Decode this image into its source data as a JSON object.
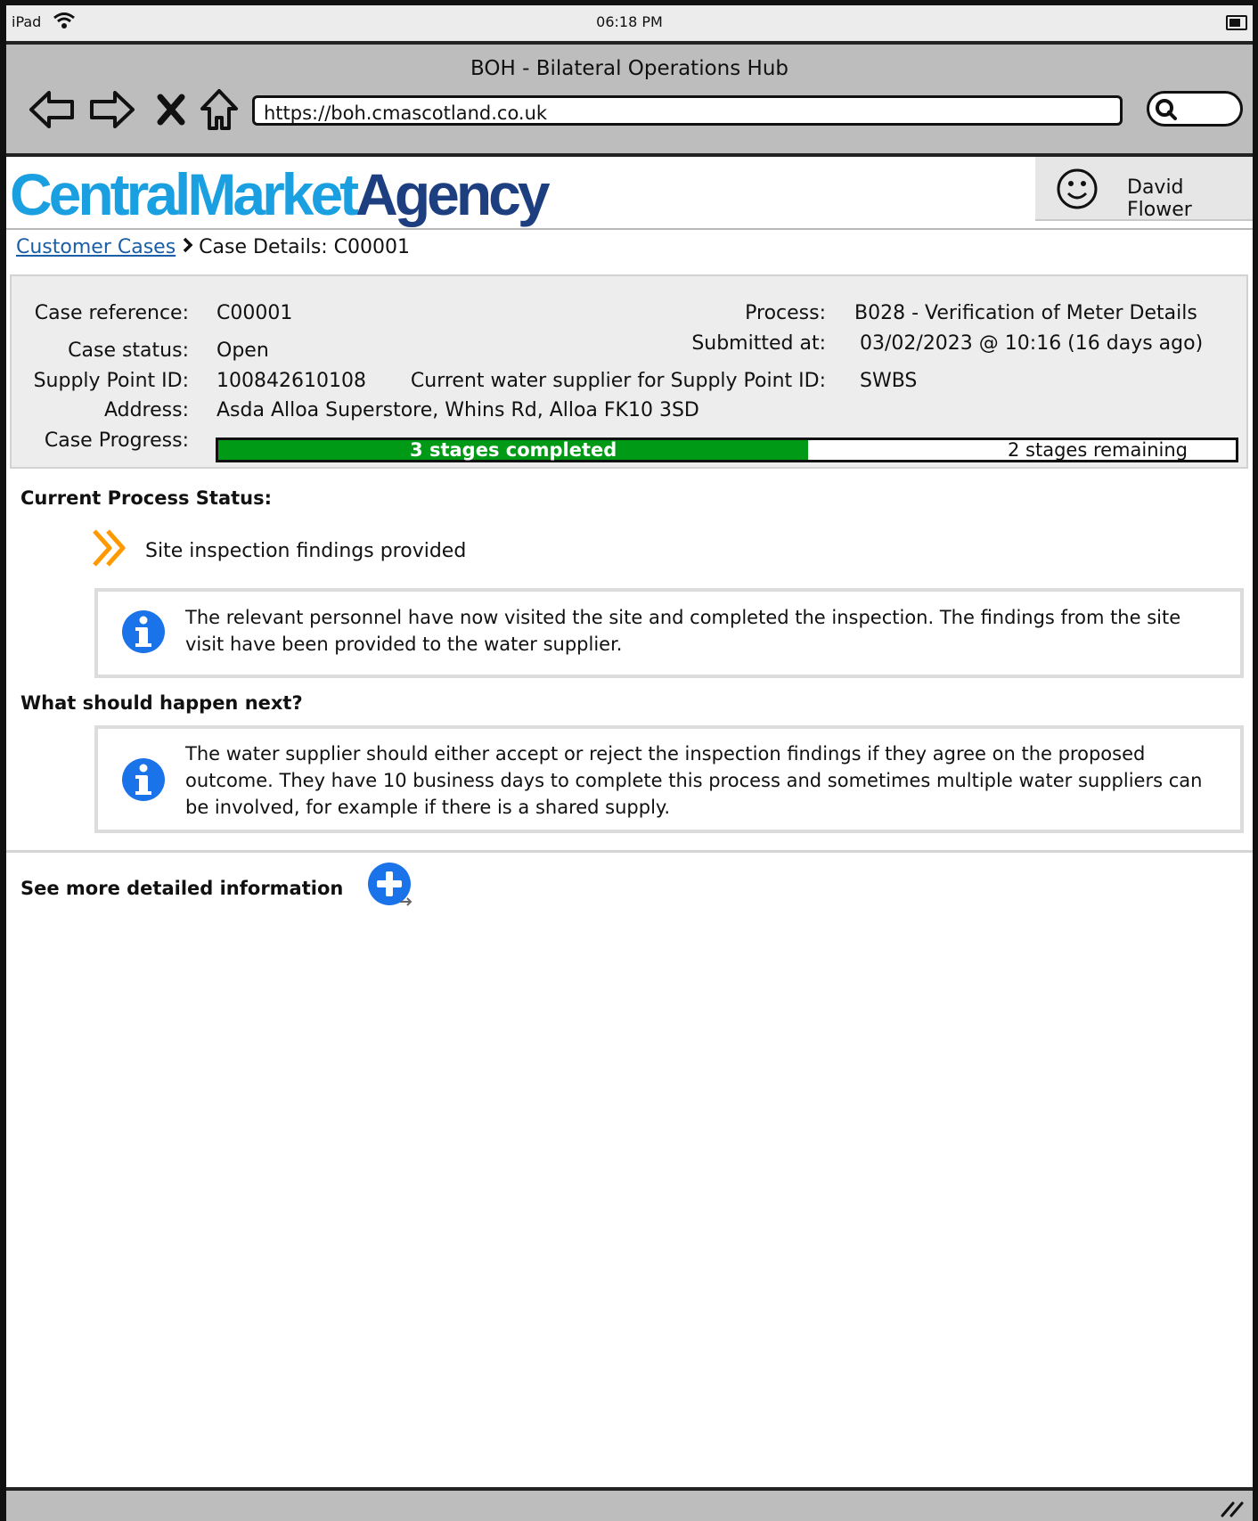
{
  "status_bar": {
    "device": "iPad",
    "time": "06:18 PM"
  },
  "browser": {
    "title": "BOH - Bilateral Operations Hub",
    "url": "https://boh.cmascotland.co.uk"
  },
  "header": {
    "logo_part1": "CentralMarket",
    "logo_part2": "Agency",
    "user_name": "David Flower"
  },
  "breadcrumb": {
    "link": "Customer Cases",
    "current": "Case Details: C00001"
  },
  "summary": {
    "case_reference_label": "Case reference:",
    "case_reference": "C00001",
    "case_status_label": "Case status:",
    "case_status": "Open",
    "supply_point_label": "Supply Point ID:",
    "supply_point": "100842610108",
    "address_label": "Address:",
    "address": "Asda Alloa Superstore, Whins Rd, Alloa FK10 3SD",
    "progress_label": "Case Progress:",
    "process_label": "Process:",
    "process": "B028 - Verification of Meter Details",
    "submitted_label": "Submitted at:",
    "submitted": "03/02/2023 @ 10:16 (16 days ago)",
    "supplier_label": "Current water supplier for Supply Point ID:",
    "supplier": "SWBS"
  },
  "progress": {
    "completed_text": "3 stages completed",
    "remaining_text": "2 stages remaining",
    "fraction": 0.58
  },
  "current_status": {
    "heading": "Current Process Status:",
    "status": "Site inspection findings provided",
    "info": "The relevant personnel have now visited the site and completed the inspection. The findings from the site visit have been provided to the water supplier."
  },
  "next_steps": {
    "heading": "What should happen next?",
    "info": "The water supplier should either accept or reject the inspection findings if they agree on the proposed outcome. They have 10 business days to complete this process and sometimes multiple water suppliers can be involved, for example if there is a shared supply."
  },
  "more": {
    "label": "See more detailed information"
  },
  "colors": {
    "progress_green": "#009a17",
    "info_blue": "#1a73e8",
    "arrow_orange": "#ff9900",
    "logo_light": "#1a9fe0",
    "logo_dark": "#1d3f80"
  }
}
